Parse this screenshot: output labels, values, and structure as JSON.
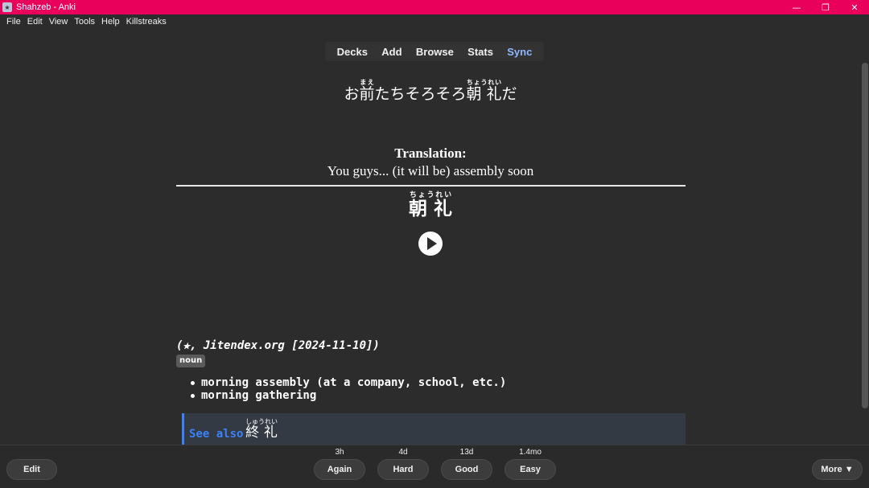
{
  "window": {
    "title": "Shahzeb - Anki",
    "minimize_glyph": "—",
    "maximize_glyph": "❐",
    "close_glyph": "✕"
  },
  "menu": {
    "items": [
      "File",
      "Edit",
      "View",
      "Tools",
      "Help",
      "Killstreaks"
    ]
  },
  "nav": {
    "items": [
      "Decks",
      "Add",
      "Browse",
      "Stats",
      "Sync"
    ],
    "active_color": "#8fb7ff"
  },
  "card": {
    "sentence_prefix": "お",
    "sentence_kanji1": "前",
    "sentence_kanji1_reading": "まえ",
    "sentence_middle": "たちそろそろ",
    "sentence_kanji2": "朝 礼",
    "sentence_kanji2_reading": "ちょうれい",
    "sentence_suffix": "だ",
    "translation_label": "Translation:",
    "translation_text": "You guys... (it will be) assembly soon",
    "vocab_word": "朝 礼",
    "vocab_reading": "ちょうれい",
    "source": "(★, Jitendex.org [2024-11-10])",
    "pos_tag": "noun",
    "glosses": [
      "morning assembly (at a company, school, etc.)",
      "morning gathering"
    ],
    "see_also_label": "See also",
    "see_also_word": "終 礼",
    "see_also_reading": "しゅうれい"
  },
  "answers": {
    "edit_label": "Edit",
    "more_label": "More ▼",
    "buttons": [
      {
        "label": "Again",
        "interval": "3h"
      },
      {
        "label": "Hard",
        "interval": "4d"
      },
      {
        "label": "Good",
        "interval": "13d"
      },
      {
        "label": "Easy",
        "interval": "1.4mo"
      }
    ]
  },
  "colors": {
    "titlebar": "#e8005a",
    "background": "#2c2c2c",
    "see_also_accent": "#3b82f6"
  }
}
